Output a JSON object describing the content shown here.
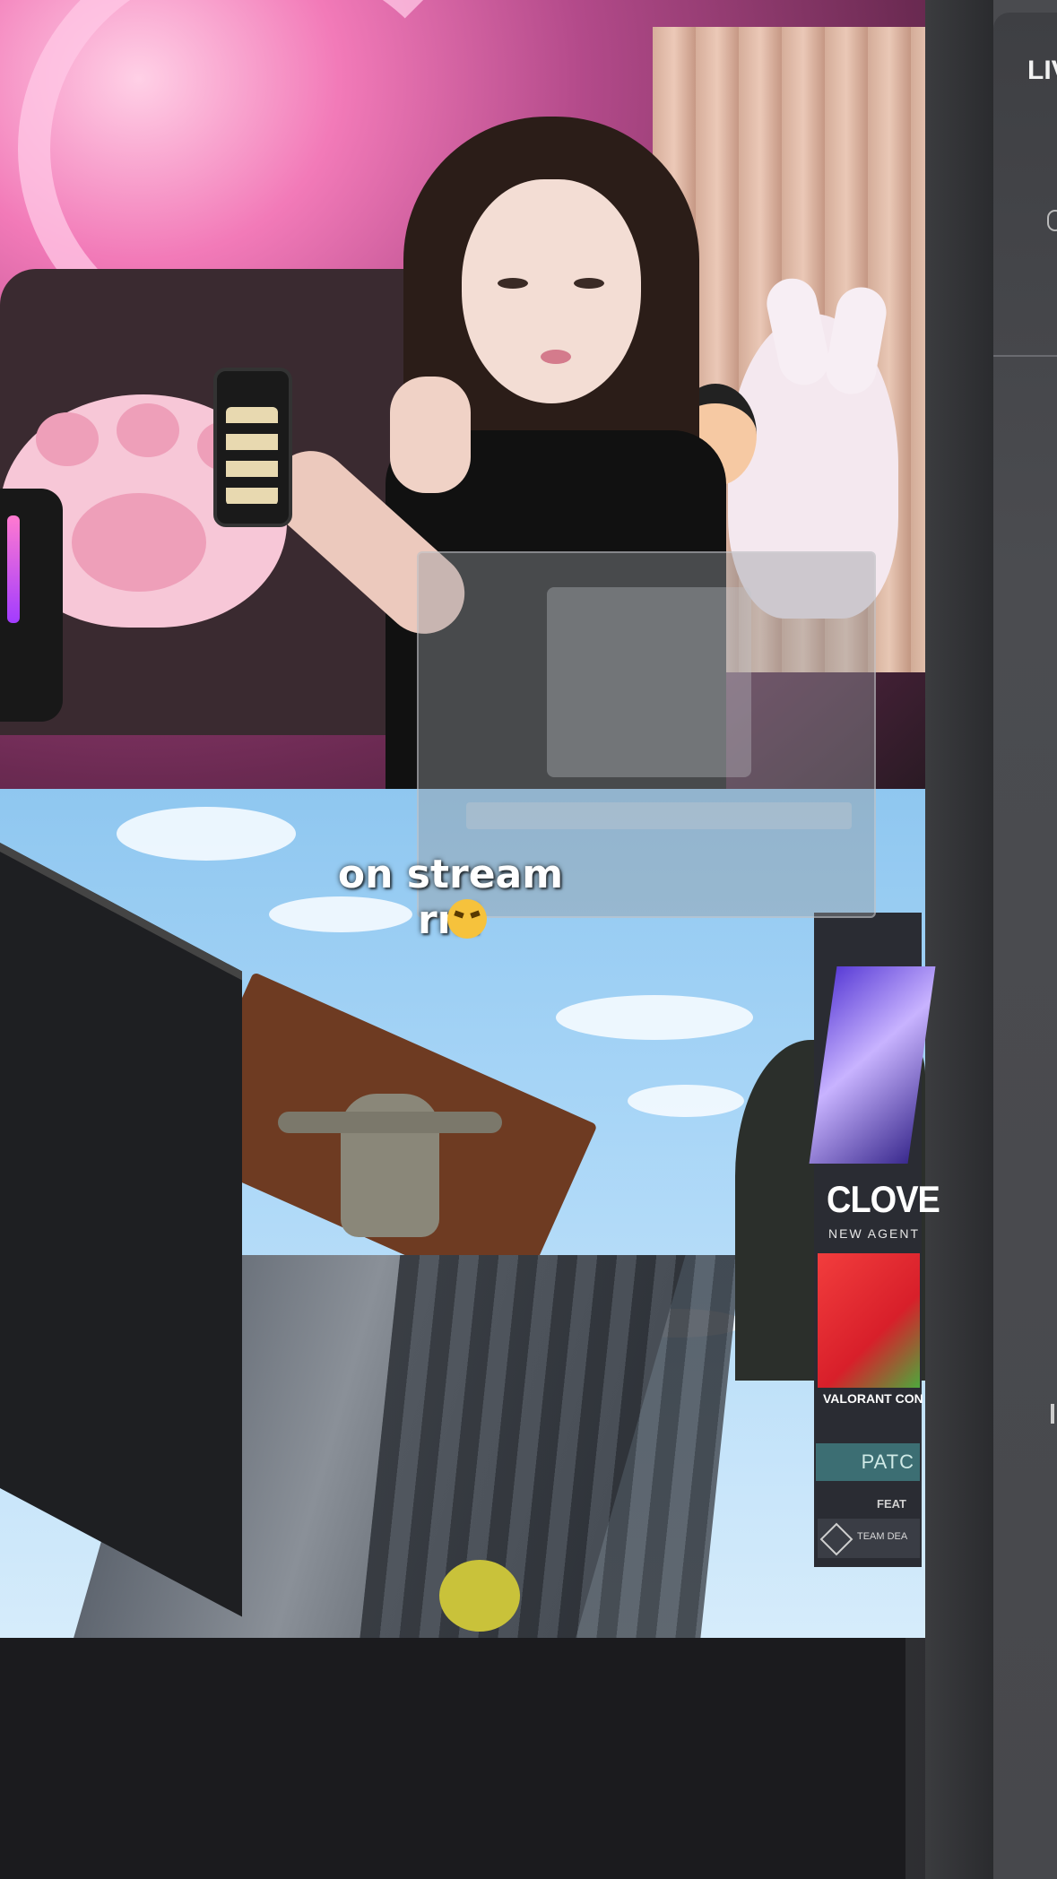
{
  "caption": {
    "text": "on stream rn!",
    "emoji": "pouting-cat-emoji"
  },
  "side_panel": {
    "header": "LIV"
  },
  "game_panel": {
    "agent_name": "CLOVE",
    "agent_subtitle": "NEW AGENT",
    "promo_title": "VALORANT CON",
    "patch_label": "PATC",
    "featured_label": "FEAT",
    "mode_label": "TEAM DEA"
  },
  "colors": {
    "accent_pink": "#f27ab8",
    "patch_teal": "#3c6e73",
    "promo_red": "#f23d3d"
  }
}
